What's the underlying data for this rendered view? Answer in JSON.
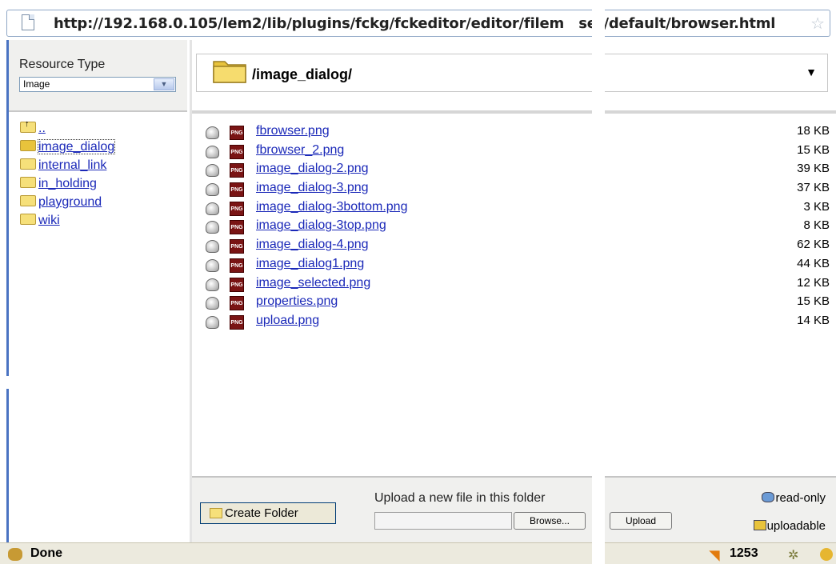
{
  "browser": {
    "url": "http://192.168.0.105/lem2/lib/plugins/fckg/fckeditor/editor/filem   ser/default/browser.html",
    "status_text": "Done",
    "counter": "1253"
  },
  "resource_type": {
    "label": "Resource Type",
    "selected": "Image"
  },
  "folders": [
    {
      "label": "..",
      "kind": "up"
    },
    {
      "label": "image_dialog",
      "kind": "open",
      "selected": true
    },
    {
      "label": "internal_link",
      "kind": "folder"
    },
    {
      "label": "in_holding",
      "kind": "folder"
    },
    {
      "label": "playground",
      "kind": "folder"
    },
    {
      "label": "wiki",
      "kind": "folder"
    }
  ],
  "current_path": "/image_dialog/",
  "files": [
    {
      "name": "fbrowser.png",
      "size": "18 KB"
    },
    {
      "name": "fbrowser_2.png",
      "size": "15 KB"
    },
    {
      "name": "image_dialog-2.png",
      "size": "39 KB"
    },
    {
      "name": "image_dialog-3.png",
      "size": "37 KB"
    },
    {
      "name": "image_dialog-3bottom.png",
      "size": "3 KB"
    },
    {
      "name": "image_dialog-3top.png",
      "size": "8 KB"
    },
    {
      "name": "image_dialog-4.png",
      "size": "62 KB"
    },
    {
      "name": "image_dialog1.png",
      "size": "44 KB"
    },
    {
      "name": "image_selected.png",
      "size": "12 KB"
    },
    {
      "name": "properties.png",
      "size": "15 KB"
    },
    {
      "name": "upload.png",
      "size": "14 KB"
    }
  ],
  "file_icon_text": "PNG",
  "upload": {
    "create_folder_label": "Create Folder",
    "instructions": "Upload a new file in this folder",
    "browse_label": "Browse...",
    "upload_label": "Upload",
    "file_value": ""
  },
  "legend": {
    "read_only": "read-only",
    "uploadable": "uploadable"
  }
}
